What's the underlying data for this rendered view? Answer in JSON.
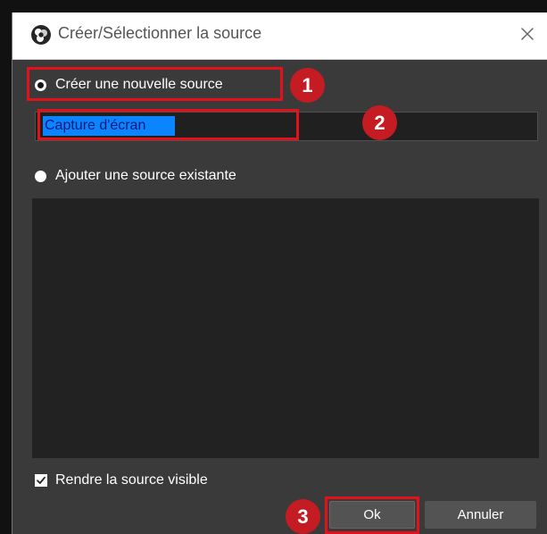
{
  "window": {
    "title": "Créer/Sélectionner la source"
  },
  "options": {
    "create_new": "Créer une nouvelle source",
    "add_existing": "Ajouter une source existante",
    "visible_checkbox": "Rendre la source visible"
  },
  "input": {
    "value": "Capture d'écran"
  },
  "buttons": {
    "ok": "Ok",
    "cancel": "Annuler"
  },
  "annotations": {
    "step_1": "1",
    "step_2": "2",
    "step_3": "3"
  },
  "colors": {
    "highlight": "#e2111a",
    "badge": "#c51b23",
    "selection": "#0a84ff"
  },
  "icons": {
    "app": "obs-logo-icon",
    "close": "close-icon",
    "checkbox": "checkmark-icon"
  }
}
